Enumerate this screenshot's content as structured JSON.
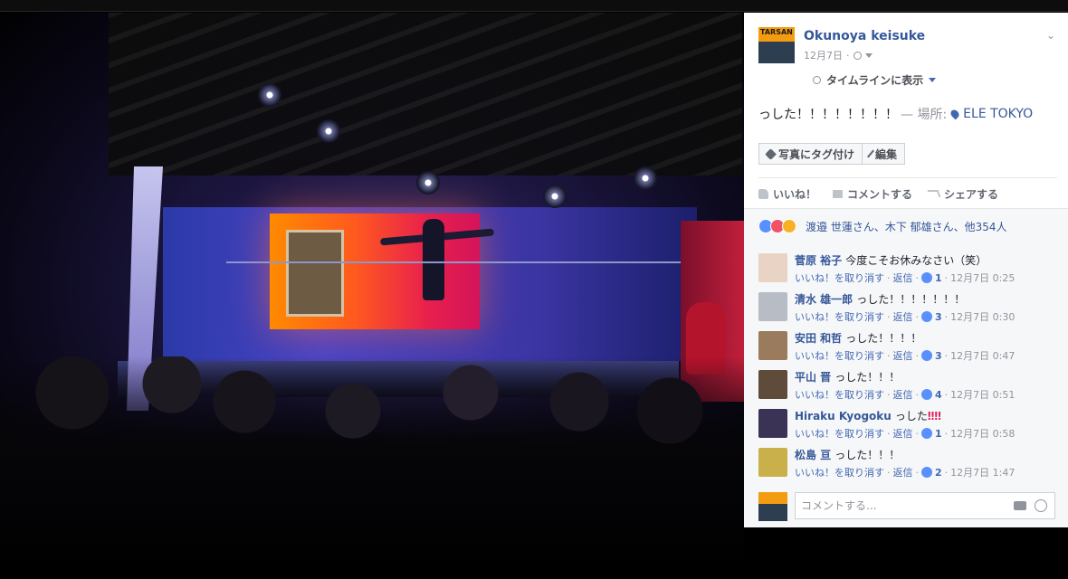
{
  "post": {
    "author": "Okunoya keisuke",
    "date": "12月7日",
    "date_sep": "·",
    "avatar_text": "TARSAN",
    "timeline_label": "タイムラインに表示",
    "text": "っした！！！！！！！！",
    "place_prefix": "— 場所:",
    "place": "ELE TOKYO",
    "tag_button": "写真にタグ付け",
    "edit_button": "編集"
  },
  "actions": {
    "like": "いいね！",
    "comment": "コメントする",
    "share": "シェアする"
  },
  "reactions": {
    "summary": "渡邉 世蓮さん、木下 郁雄さん、他354人"
  },
  "comments": [
    {
      "author": "菅原 裕子",
      "text": "今度こそお休みなさい（笑）",
      "unlike": "いいね！を取り消す",
      "reply": "返信",
      "likes": "1",
      "time": "12月7日 0:25",
      "avatar_color": "#e8d3c4"
    },
    {
      "author": "清水 雄一郎",
      "text": "っした！！！！！！！",
      "unlike": "いいね！を取り消す",
      "reply": "返信",
      "likes": "3",
      "time": "12月7日 0:30",
      "avatar_color": "#b8bcc4"
    },
    {
      "author": "安田 和哲",
      "text": "っした！！！！",
      "unlike": "いいね！を取り消す",
      "reply": "返信",
      "likes": "3",
      "time": "12月7日 0:47",
      "avatar_color": "#9a7b5e"
    },
    {
      "author": "平山 晋",
      "text": "っした！！！",
      "unlike": "いいね！を取り消す",
      "reply": "返信",
      "likes": "4",
      "time": "12月7日 0:51",
      "avatar_color": "#5e4b3a"
    },
    {
      "author": "Hiraku Kyogoku",
      "text": "っした",
      "bangs": "‼‼",
      "unlike": "いいね！を取り消す",
      "reply": "返信",
      "likes": "1",
      "time": "12月7日 0:58",
      "avatar_color": "#3b3355"
    },
    {
      "author": "松島 亘",
      "text": "っした！！！",
      "unlike": "いいね！を取り消す",
      "reply": "返信",
      "likes": "2",
      "time": "12月7日 1:47",
      "avatar_color": "#c9b04a"
    }
  ],
  "comment_box": {
    "placeholder": "コメントする..."
  },
  "comment_sep": "·"
}
